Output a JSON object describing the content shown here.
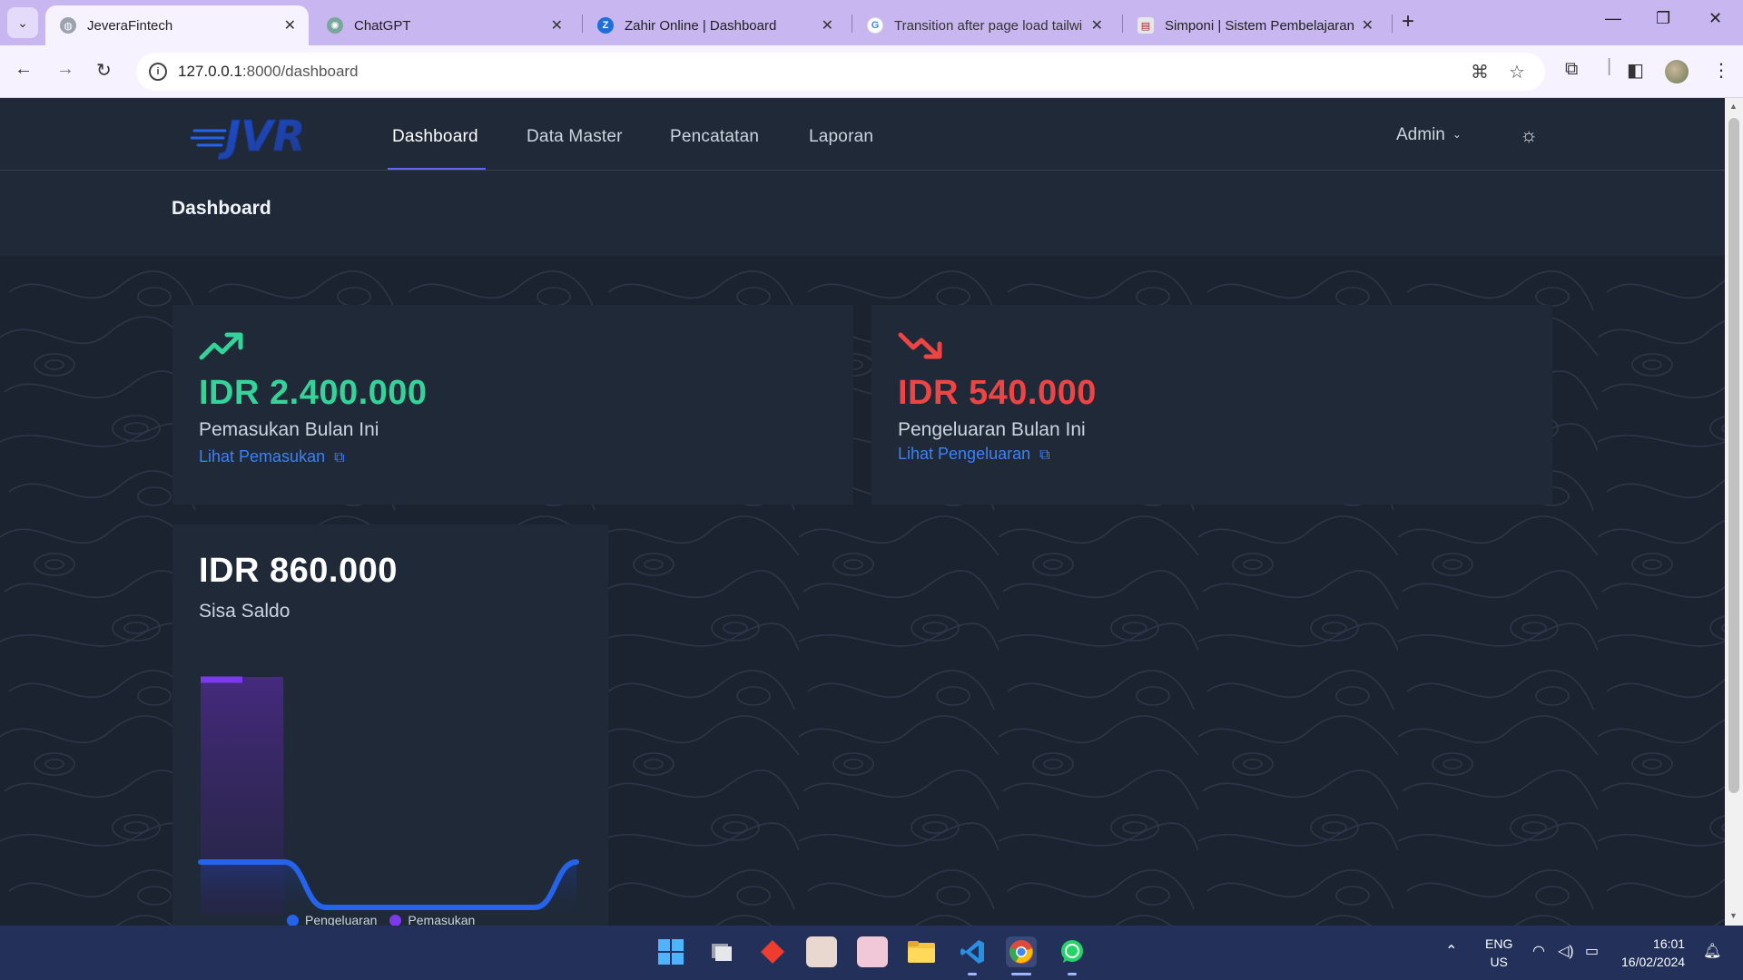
{
  "browser": {
    "tabs": [
      {
        "title": "JeveraFintech",
        "favicon": "globe-icon",
        "active": true
      },
      {
        "title": "ChatGPT",
        "favicon": "chatgpt-icon",
        "active": false
      },
      {
        "title": "Zahir Online | Dashboard",
        "favicon": "zahir-icon",
        "active": false
      },
      {
        "title": "Transition after page load tailwi",
        "favicon": "google-icon",
        "active": false
      },
      {
        "title": "Simponi | Sistem Pembelajaran",
        "favicon": "simponi-icon",
        "active": false
      }
    ],
    "url_host": "127.0.0.1",
    "url_path": ":8000/dashboard"
  },
  "nav": {
    "logo_text": "JVR",
    "links": [
      "Dashboard",
      "Data Master",
      "Pencatatan",
      "Laporan"
    ],
    "active_link": "Dashboard",
    "user": "Admin"
  },
  "page": {
    "title": "Dashboard"
  },
  "income": {
    "amount": "IDR 2.400.000",
    "label": "Pemasukan Bulan Ini",
    "link": "Lihat Pemasukan",
    "color": "#34d399",
    "icon": "trend-up-icon"
  },
  "expense": {
    "amount": "IDR 540.000",
    "label": "Pengeluaran Bulan Ini",
    "link": "Lihat Pengeluaran",
    "color": "#ef4444",
    "icon": "trend-down-icon"
  },
  "balance": {
    "amount": "IDR 860.000",
    "label": "Sisa Saldo"
  },
  "chart_data": {
    "type": "line",
    "series": [
      {
        "name": "Pengeluaran",
        "color": "#2563eb",
        "values": [
          540000,
          540000,
          540000,
          0,
          0,
          0,
          0,
          0,
          0,
          540000
        ]
      },
      {
        "name": "Pemasukan",
        "color": "#7c3aed",
        "values": [
          2400000,
          2400000,
          0,
          0,
          0,
          0,
          0,
          0,
          0,
          0
        ]
      }
    ],
    "legend_position": "bottom",
    "grid": false
  },
  "taskbar": {
    "apps": [
      "windows-start-icon",
      "task-view-icon",
      "git-icon",
      "anime-app-icon",
      "anime-app-icon-2",
      "file-explorer-icon",
      "vscode-icon",
      "chrome-icon",
      "whatsapp-icon"
    ],
    "lang_top": "ENG",
    "lang_bottom": "US",
    "time": "16:01",
    "date": "16/02/2024"
  }
}
